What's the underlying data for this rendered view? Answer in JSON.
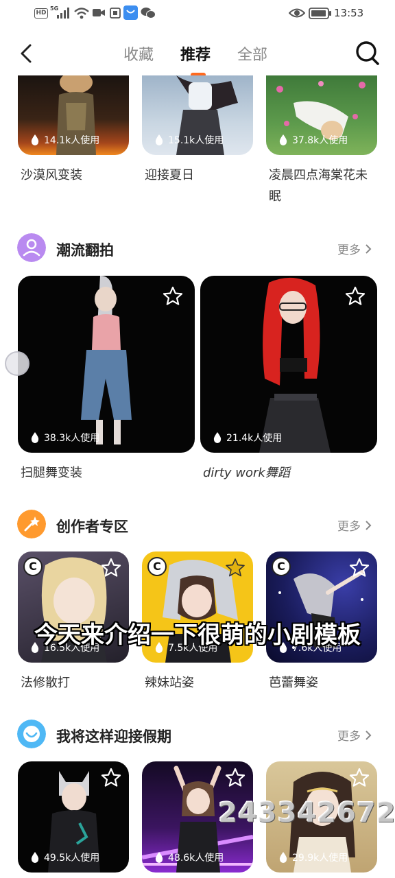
{
  "status_bar": {
    "network_badge": "HD",
    "network_type": "5G",
    "time": "13:53"
  },
  "header": {
    "tabs": [
      {
        "label": "收藏"
      },
      {
        "label": "推荐"
      },
      {
        "label": "全部"
      }
    ],
    "active_tab": "推荐"
  },
  "top_row": [
    {
      "usage": "14.1k人使用",
      "title": "沙漠风变装"
    },
    {
      "usage": "15.1k人使用",
      "title": "迎接夏日"
    },
    {
      "usage": "37.8k人使用",
      "title": "凌晨四点海棠花未眠"
    }
  ],
  "sections": [
    {
      "title": "潮流翻拍",
      "more": "更多",
      "items": [
        {
          "usage": "38.3k人使用",
          "title": "扫腿舞变装"
        },
        {
          "usage": "21.4k人使用",
          "title": "dirty work舞蹈"
        }
      ]
    },
    {
      "title": "创作者专区",
      "more": "更多",
      "items": [
        {
          "usage": "16.5k人使用",
          "title": "法修散打",
          "badge": "C"
        },
        {
          "usage": "7.5k人使用",
          "title": "辣妹站姿",
          "badge": "C"
        },
        {
          "usage": "7.6k人使用",
          "title": "芭蕾舞姿",
          "badge": "C"
        }
      ]
    },
    {
      "title": "我将这样迎接假期",
      "more": "更多",
      "items": [
        {
          "usage": "49.5k人使用"
        },
        {
          "usage": "48.6k人使用"
        },
        {
          "usage": "29.9k人使用"
        }
      ]
    }
  ],
  "overlay": {
    "caption": "今天来介绍一下很萌的小剧模板",
    "watermark": "243342672"
  },
  "colors": {
    "accent": "#ff6a1f",
    "favorited_star": "#f2c31c",
    "section_icon_trend": "#b98af0",
    "section_icon_creator": "#ff9a2e",
    "section_icon_holiday": "#4fb8f5"
  }
}
